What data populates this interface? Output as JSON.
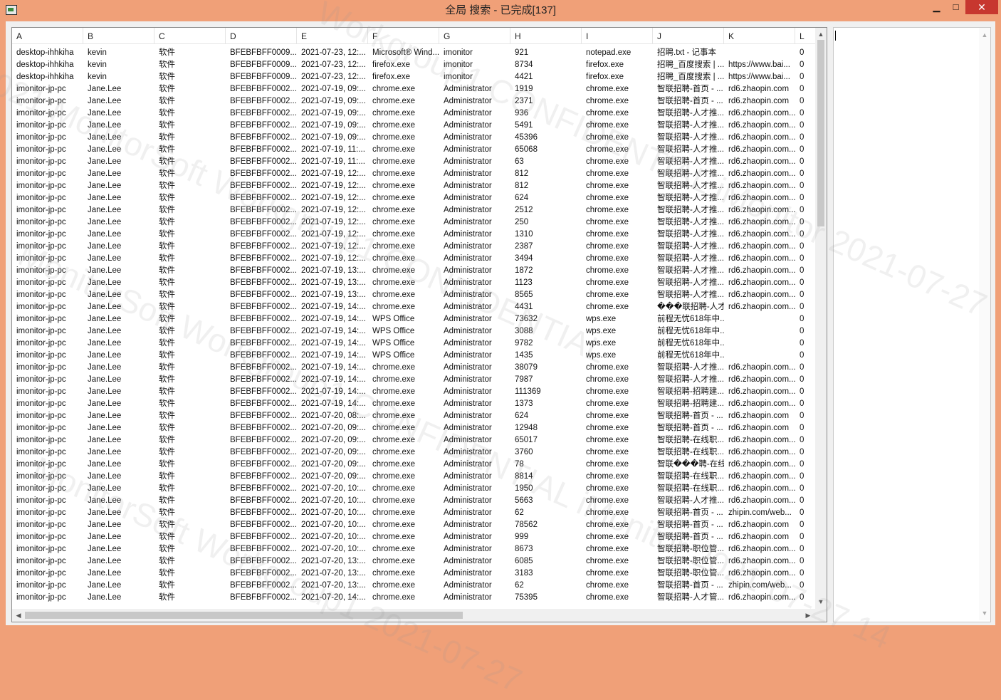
{
  "window": {
    "title": "全局 搜索 - 已完成[137]",
    "minimize": "▁",
    "maximize": "□",
    "close": "✕"
  },
  "columns": [
    "A",
    "B",
    "C",
    "D",
    "E",
    "F",
    "G",
    "H",
    "I",
    "J",
    "K",
    "L"
  ],
  "rows": [
    [
      "desktop-ihhkiha",
      "kevin",
      "软件",
      "BFEBFBFF0009...",
      "2021-07-23, 12:...",
      "Microsoft® Wind...",
      "imonitor",
      "921",
      "notepad.exe",
      "招聘.txt - 记事本",
      "",
      "0"
    ],
    [
      "desktop-ihhkiha",
      "kevin",
      "软件",
      "BFEBFBFF0009...",
      "2021-07-23, 12:...",
      "firefox.exe",
      "imonitor",
      "8734",
      "firefox.exe",
      "招聘_百度搜索 | ...",
      "https://www.bai...",
      "0"
    ],
    [
      "desktop-ihhkiha",
      "kevin",
      "软件",
      "BFEBFBFF0009...",
      "2021-07-23, 12:...",
      "firefox.exe",
      "imonitor",
      "4421",
      "firefox.exe",
      "招聘_百度搜索 | ...",
      "https://www.bai...",
      "0"
    ],
    [
      "imonitor-jp-pc",
      "Jane.Lee",
      "软件",
      "BFEBFBFF0002...",
      "2021-07-19, 09:...",
      "chrome.exe",
      "Administrator",
      "1919",
      "chrome.exe",
      "智联招聘-首页 - ...",
      "rd6.zhaopin.com",
      "0"
    ],
    [
      "imonitor-jp-pc",
      "Jane.Lee",
      "软件",
      "BFEBFBFF0002...",
      "2021-07-19, 09:...",
      "chrome.exe",
      "Administrator",
      "2371",
      "chrome.exe",
      "智联招聘-首页 - ...",
      "rd6.zhaopin.com",
      "0"
    ],
    [
      "imonitor-jp-pc",
      "Jane.Lee",
      "软件",
      "BFEBFBFF0002...",
      "2021-07-19, 09:...",
      "chrome.exe",
      "Administrator",
      "936",
      "chrome.exe",
      "智联招聘-人才推...",
      "rd6.zhaopin.com...",
      "0"
    ],
    [
      "imonitor-jp-pc",
      "Jane.Lee",
      "软件",
      "BFEBFBFF0002...",
      "2021-07-19, 09:...",
      "chrome.exe",
      "Administrator",
      "5491",
      "chrome.exe",
      "智联招聘-人才推...",
      "rd6.zhaopin.com...",
      "0"
    ],
    [
      "imonitor-jp-pc",
      "Jane.Lee",
      "软件",
      "BFEBFBFF0002...",
      "2021-07-19, 09:...",
      "chrome.exe",
      "Administrator",
      "45396",
      "chrome.exe",
      "智联招聘-人才推...",
      "rd6.zhaopin.com...",
      "0"
    ],
    [
      "imonitor-jp-pc",
      "Jane.Lee",
      "软件",
      "BFEBFBFF0002...",
      "2021-07-19, 11:...",
      "chrome.exe",
      "Administrator",
      "65068",
      "chrome.exe",
      "智联招聘-人才推...",
      "rd6.zhaopin.com...",
      "0"
    ],
    [
      "imonitor-jp-pc",
      "Jane.Lee",
      "软件",
      "BFEBFBFF0002...",
      "2021-07-19, 11:...",
      "chrome.exe",
      "Administrator",
      "63",
      "chrome.exe",
      "智联招聘-人才推...",
      "rd6.zhaopin.com...",
      "0"
    ],
    [
      "imonitor-jp-pc",
      "Jane.Lee",
      "软件",
      "BFEBFBFF0002...",
      "2021-07-19, 12:...",
      "chrome.exe",
      "Administrator",
      "812",
      "chrome.exe",
      "智联招聘-人才推...",
      "rd6.zhaopin.com...",
      "0"
    ],
    [
      "imonitor-jp-pc",
      "Jane.Lee",
      "软件",
      "BFEBFBFF0002...",
      "2021-07-19, 12:...",
      "chrome.exe",
      "Administrator",
      "812",
      "chrome.exe",
      "智联招聘-人才推...",
      "rd6.zhaopin.com...",
      "0"
    ],
    [
      "imonitor-jp-pc",
      "Jane.Lee",
      "软件",
      "BFEBFBFF0002...",
      "2021-07-19, 12:...",
      "chrome.exe",
      "Administrator",
      "624",
      "chrome.exe",
      "智联招聘-人才推...",
      "rd6.zhaopin.com...",
      "0"
    ],
    [
      "imonitor-jp-pc",
      "Jane.Lee",
      "软件",
      "BFEBFBFF0002...",
      "2021-07-19, 12:...",
      "chrome.exe",
      "Administrator",
      "2512",
      "chrome.exe",
      "智联招聘-人才推...",
      "rd6.zhaopin.com...",
      "0"
    ],
    [
      "imonitor-jp-pc",
      "Jane.Lee",
      "软件",
      "BFEBFBFF0002...",
      "2021-07-19, 12:...",
      "chrome.exe",
      "Administrator",
      "250",
      "chrome.exe",
      "智联招聘-人才推...",
      "rd6.zhaopin.com...",
      "0"
    ],
    [
      "imonitor-jp-pc",
      "Jane.Lee",
      "软件",
      "BFEBFBFF0002...",
      "2021-07-19, 12:...",
      "chrome.exe",
      "Administrator",
      "1310",
      "chrome.exe",
      "智联招聘-人才推...",
      "rd6.zhaopin.com...",
      "0"
    ],
    [
      "imonitor-jp-pc",
      "Jane.Lee",
      "软件",
      "BFEBFBFF0002...",
      "2021-07-19, 12:...",
      "chrome.exe",
      "Administrator",
      "2387",
      "chrome.exe",
      "智联招聘-人才推...",
      "rd6.zhaopin.com...",
      "0"
    ],
    [
      "imonitor-jp-pc",
      "Jane.Lee",
      "软件",
      "BFEBFBFF0002...",
      "2021-07-19, 12:...",
      "chrome.exe",
      "Administrator",
      "3494",
      "chrome.exe",
      "智联招聘-人才推...",
      "rd6.zhaopin.com...",
      "0"
    ],
    [
      "imonitor-jp-pc",
      "Jane.Lee",
      "软件",
      "BFEBFBFF0002...",
      "2021-07-19, 13:...",
      "chrome.exe",
      "Administrator",
      "1872",
      "chrome.exe",
      "智联招聘-人才推...",
      "rd6.zhaopin.com...",
      "0"
    ],
    [
      "imonitor-jp-pc",
      "Jane.Lee",
      "软件",
      "BFEBFBFF0002...",
      "2021-07-19, 13:...",
      "chrome.exe",
      "Administrator",
      "1123",
      "chrome.exe",
      "智联招聘-人才推...",
      "rd6.zhaopin.com...",
      "0"
    ],
    [
      "imonitor-jp-pc",
      "Jane.Lee",
      "软件",
      "BFEBFBFF0002...",
      "2021-07-19, 13:...",
      "chrome.exe",
      "Administrator",
      "8565",
      "chrome.exe",
      "智联招聘-人才推...",
      "rd6.zhaopin.com...",
      "0"
    ],
    [
      "imonitor-jp-pc",
      "Jane.Lee",
      "软件",
      "BFEBFBFF0002...",
      "2021-07-19, 14:...",
      "chrome.exe",
      "Administrator",
      "4431",
      "chrome.exe",
      "���联招聘-人才...",
      "rd6.zhaopin.com...",
      "0"
    ],
    [
      "imonitor-jp-pc",
      "Jane.Lee",
      "软件",
      "BFEBFBFF0002...",
      "2021-07-19, 14:...",
      "WPS Office",
      "Administrator",
      "73632",
      "wps.exe",
      "前程无忧618年中...",
      "",
      "0"
    ],
    [
      "imonitor-jp-pc",
      "Jane.Lee",
      "软件",
      "BFEBFBFF0002...",
      "2021-07-19, 14:...",
      "WPS Office",
      "Administrator",
      "3088",
      "wps.exe",
      "前程无忧618年中...",
      "",
      "0"
    ],
    [
      "imonitor-jp-pc",
      "Jane.Lee",
      "软件",
      "BFEBFBFF0002...",
      "2021-07-19, 14:...",
      "WPS Office",
      "Administrator",
      "9782",
      "wps.exe",
      "前程无忧618年中...",
      "",
      "0"
    ],
    [
      "imonitor-jp-pc",
      "Jane.Lee",
      "软件",
      "BFEBFBFF0002...",
      "2021-07-19, 14:...",
      "WPS Office",
      "Administrator",
      "1435",
      "wps.exe",
      "前程无忧618年中...",
      "",
      "0"
    ],
    [
      "imonitor-jp-pc",
      "Jane.Lee",
      "软件",
      "BFEBFBFF0002...",
      "2021-07-19, 14:...",
      "chrome.exe",
      "Administrator",
      "38079",
      "chrome.exe",
      "智联招聘-人才推...",
      "rd6.zhaopin.com...",
      "0"
    ],
    [
      "imonitor-jp-pc",
      "Jane.Lee",
      "软件",
      "BFEBFBFF0002...",
      "2021-07-19, 14:...",
      "chrome.exe",
      "Administrator",
      "7987",
      "chrome.exe",
      "智联招聘-人才推...",
      "rd6.zhaopin.com...",
      "0"
    ],
    [
      "imonitor-jp-pc",
      "Jane.Lee",
      "软件",
      "BFEBFBFF0002...",
      "2021-07-19, 14:...",
      "chrome.exe",
      "Administrator",
      "111369",
      "chrome.exe",
      "智联招聘-招聘建...",
      "rd6.zhaopin.com...",
      "0"
    ],
    [
      "imonitor-jp-pc",
      "Jane.Lee",
      "软件",
      "BFEBFBFF0002...",
      "2021-07-19, 14:...",
      "chrome.exe",
      "Administrator",
      "1373",
      "chrome.exe",
      "智联招聘-招聘建...",
      "rd6.zhaopin.com...",
      "0"
    ],
    [
      "imonitor-jp-pc",
      "Jane.Lee",
      "软件",
      "BFEBFBFF0002...",
      "2021-07-20, 08:...",
      "chrome.exe",
      "Administrator",
      "624",
      "chrome.exe",
      "智联招聘-首页 - ...",
      "rd6.zhaopin.com",
      "0"
    ],
    [
      "imonitor-jp-pc",
      "Jane.Lee",
      "软件",
      "BFEBFBFF0002...",
      "2021-07-20, 09:...",
      "chrome.exe",
      "Administrator",
      "12948",
      "chrome.exe",
      "智联招聘-首页 - ...",
      "rd6.zhaopin.com",
      "0"
    ],
    [
      "imonitor-jp-pc",
      "Jane.Lee",
      "软件",
      "BFEBFBFF0002...",
      "2021-07-20, 09:...",
      "chrome.exe",
      "Administrator",
      "65017",
      "chrome.exe",
      "智联招聘-在线职...",
      "rd6.zhaopin.com...",
      "0"
    ],
    [
      "imonitor-jp-pc",
      "Jane.Lee",
      "软件",
      "BFEBFBFF0002...",
      "2021-07-20, 09:...",
      "chrome.exe",
      "Administrator",
      "3760",
      "chrome.exe",
      "智联招聘-在线职...",
      "rd6.zhaopin.com...",
      "0"
    ],
    [
      "imonitor-jp-pc",
      "Jane.Lee",
      "软件",
      "BFEBFBFF0002...",
      "2021-07-20, 09:...",
      "chrome.exe",
      "Administrator",
      "78",
      "chrome.exe",
      "智联���聘-在线...",
      "rd6.zhaopin.com...",
      "0"
    ],
    [
      "imonitor-jp-pc",
      "Jane.Lee",
      "软件",
      "BFEBFBFF0002...",
      "2021-07-20, 09:...",
      "chrome.exe",
      "Administrator",
      "8814",
      "chrome.exe",
      "智联招聘-在线职...",
      "rd6.zhaopin.com...",
      "0"
    ],
    [
      "imonitor-jp-pc",
      "Jane.Lee",
      "软件",
      "BFEBFBFF0002...",
      "2021-07-20, 10:...",
      "chrome.exe",
      "Administrator",
      "1950",
      "chrome.exe",
      "智联招聘-在线职...",
      "rd6.zhaopin.com...",
      "0"
    ],
    [
      "imonitor-jp-pc",
      "Jane.Lee",
      "软件",
      "BFEBFBFF0002...",
      "2021-07-20, 10:...",
      "chrome.exe",
      "Administrator",
      "5663",
      "chrome.exe",
      "智联招聘-人才推...",
      "rd6.zhaopin.com...",
      "0"
    ],
    [
      "imonitor-jp-pc",
      "Jane.Lee",
      "软件",
      "BFEBFBFF0002...",
      "2021-07-20, 10:...",
      "chrome.exe",
      "Administrator",
      "62",
      "chrome.exe",
      "智联招聘-首页 - ...",
      "zhipin.com/web...",
      "0"
    ],
    [
      "imonitor-jp-pc",
      "Jane.Lee",
      "软件",
      "BFEBFBFF0002...",
      "2021-07-20, 10:...",
      "chrome.exe",
      "Administrator",
      "78562",
      "chrome.exe",
      "智联招聘-首页 - ...",
      "rd6.zhaopin.com",
      "0"
    ],
    [
      "imonitor-jp-pc",
      "Jane.Lee",
      "软件",
      "BFEBFBFF0002...",
      "2021-07-20, 10:...",
      "chrome.exe",
      "Administrator",
      "999",
      "chrome.exe",
      "智联招聘-首页 - ...",
      "rd6.zhaopin.com",
      "0"
    ],
    [
      "imonitor-jp-pc",
      "Jane.Lee",
      "软件",
      "BFEBFBFF0002...",
      "2021-07-20, 10:...",
      "chrome.exe",
      "Administrator",
      "8673",
      "chrome.exe",
      "智联招聘-职位管...",
      "rd6.zhaopin.com...",
      "0"
    ],
    [
      "imonitor-jp-pc",
      "Jane.Lee",
      "软件",
      "BFEBFBFF0002...",
      "2021-07-20, 13:...",
      "chrome.exe",
      "Administrator",
      "6085",
      "chrome.exe",
      "智联招聘-职位管...",
      "rd6.zhaopin.com...",
      "0"
    ],
    [
      "imonitor-jp-pc",
      "Jane.Lee",
      "软件",
      "BFEBFBFF0002...",
      "2021-07-20, 13:...",
      "chrome.exe",
      "Administrator",
      "3183",
      "chrome.exe",
      "智联招聘-职位管...",
      "rd6.zhaopin.com...",
      "0"
    ],
    [
      "imonitor-jp-pc",
      "Jane.Lee",
      "软件",
      "BFEBFBFF0002...",
      "2021-07-20, 13:...",
      "chrome.exe",
      "Administrator",
      "62",
      "chrome.exe",
      "智联招聘-首页 - ...",
      "zhipin.com/web...",
      "0"
    ],
    [
      "imonitor-jp-pc",
      "Jane.Lee",
      "软件",
      "BFEBFBFF0002...",
      "2021-07-20, 14:...",
      "chrome.exe",
      "Administrator",
      "75395",
      "chrome.exe",
      "智联招聘-人才管...",
      "rd6.zhaopin.com...",
      "0"
    ]
  ],
  "scrollbar": {
    "up": "▲",
    "down": "▼",
    "left": "◀",
    "right": "▶"
  },
  "watermark": {
    "line1": "Workgroup1 CONFIDENTIAL iMonitor 2021-07-27",
    "line2": "2021 MonitorSoft Workgroup1 CONFIDENTIAL",
    "line3": "MonitorSoft Workgroup1 CONFIDENTIAL iMonitor 2021-07-27 14",
    "line4": "MonitorSoft Workgroup1 2021-07-27"
  }
}
